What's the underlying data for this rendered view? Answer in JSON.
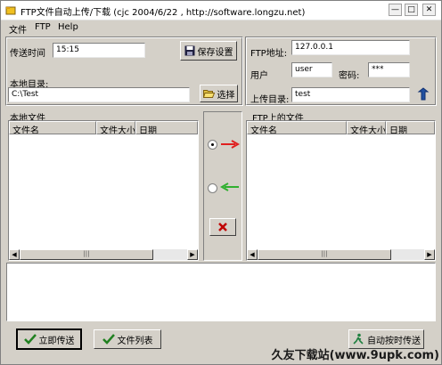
{
  "window": {
    "title": "FTP文件自动上传/下载  (cjc 2004/6/22 , http://software.longzu.net)",
    "minimize": "—",
    "maximize": "□",
    "close": "✕"
  },
  "menu": [
    "文件",
    "FTP",
    "Help"
  ],
  "schedule": {
    "send_time_label": "传送时间",
    "send_time_value": "15:15",
    "save_settings_label": "保存设置",
    "local_dir_label": "本地目录:",
    "local_dir_value": "C:\\Test",
    "select_label": "选择"
  },
  "ftp": {
    "address_label": "FTP地址:",
    "address_value": "127.0.0.1",
    "user_label": "用户",
    "user_value": "user",
    "password_label": "密码:",
    "password_value": "***",
    "upload_dir_label": "上传目录:",
    "upload_dir_value": "test"
  },
  "local_files": {
    "title": "本地文件",
    "columns": [
      "文件名",
      "文件大小",
      "日期"
    ]
  },
  "ftp_files": {
    "title": "FTP上的文件",
    "columns": [
      "文件名",
      "文件大小",
      "日期"
    ]
  },
  "transfer": {
    "upload_selected": true,
    "download_selected": false
  },
  "scroll_thumb_glyph": "|||",
  "footer": {
    "send_now_label": "立即传送",
    "file_list_label": "文件列表",
    "auto_send_label": "自动按时传送"
  },
  "watermark": "久友下载站(www.9upk.com)",
  "colors": {
    "upload_arrow": "#e02020",
    "download_arrow": "#30b030",
    "delete_x": "#c00000"
  }
}
